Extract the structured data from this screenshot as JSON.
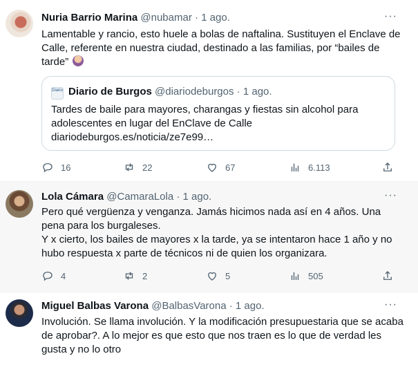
{
  "tweets": [
    {
      "name": "Nuria Barrio Marina",
      "handle": "@nubamar",
      "dot": "·",
      "time": "1 ago.",
      "text": "Lamentable y rancio, esto huele a bolas de naftalina. Sustituyen el Enclave de Calle, referente en nuestra ciudad, destinado a las familias, por “bailes de tarde”",
      "emoji": "person-facepalming-emoji",
      "quote": {
        "logo_text": "Diario de Burgos",
        "name": "Diario de Burgos",
        "handle": "@diariodeburgos",
        "dot": "·",
        "time": "1 ago.",
        "text": "Tardes de baile para mayores, charangas y fiestas sin alcohol para adolescentes en lugar del EnClave de Calle diariodeburgos.es/noticia/ze7e99…"
      },
      "stats": {
        "replies": "16",
        "retweets": "22",
        "likes": "67",
        "views": "6.113"
      }
    },
    {
      "name": "Lola Cámara",
      "handle": "@CamaraLola",
      "dot": "·",
      "time": "1 ago.",
      "text": "Pero qué vergüenza y venganza. Jamás hicimos nada así en 4 años. Una pena para los burgaleses.\nY x cierto, los bailes de mayores x la tarde, ya se intentaron hace 1 año y no hubo respuesta x parte de técnicos ni de quien los organizara.",
      "stats": {
        "replies": "4",
        "retweets": "2",
        "likes": "5",
        "views": "505"
      }
    },
    {
      "name": "Miguel Balbas Varona",
      "handle": "@BalbasVarona",
      "dot": "·",
      "time": "1 ago.",
      "text": "Involución. Se llama involución. Y la modificación presupuestaria que se acaba de aprobar?. A lo mejor es que esto que nos traen es lo que de verdad les gusta y no lo otro"
    }
  ],
  "icons": {
    "more": "more-dots-icon",
    "reply": "reply-icon",
    "retweet": "retweet-icon",
    "like": "heart-icon",
    "views": "views-bar-chart-icon",
    "share": "share-icon"
  },
  "colors": {
    "text": "#0f1419",
    "muted": "#536471",
    "border": "#cfd9de",
    "hover_bg": "#f7f7f7"
  }
}
